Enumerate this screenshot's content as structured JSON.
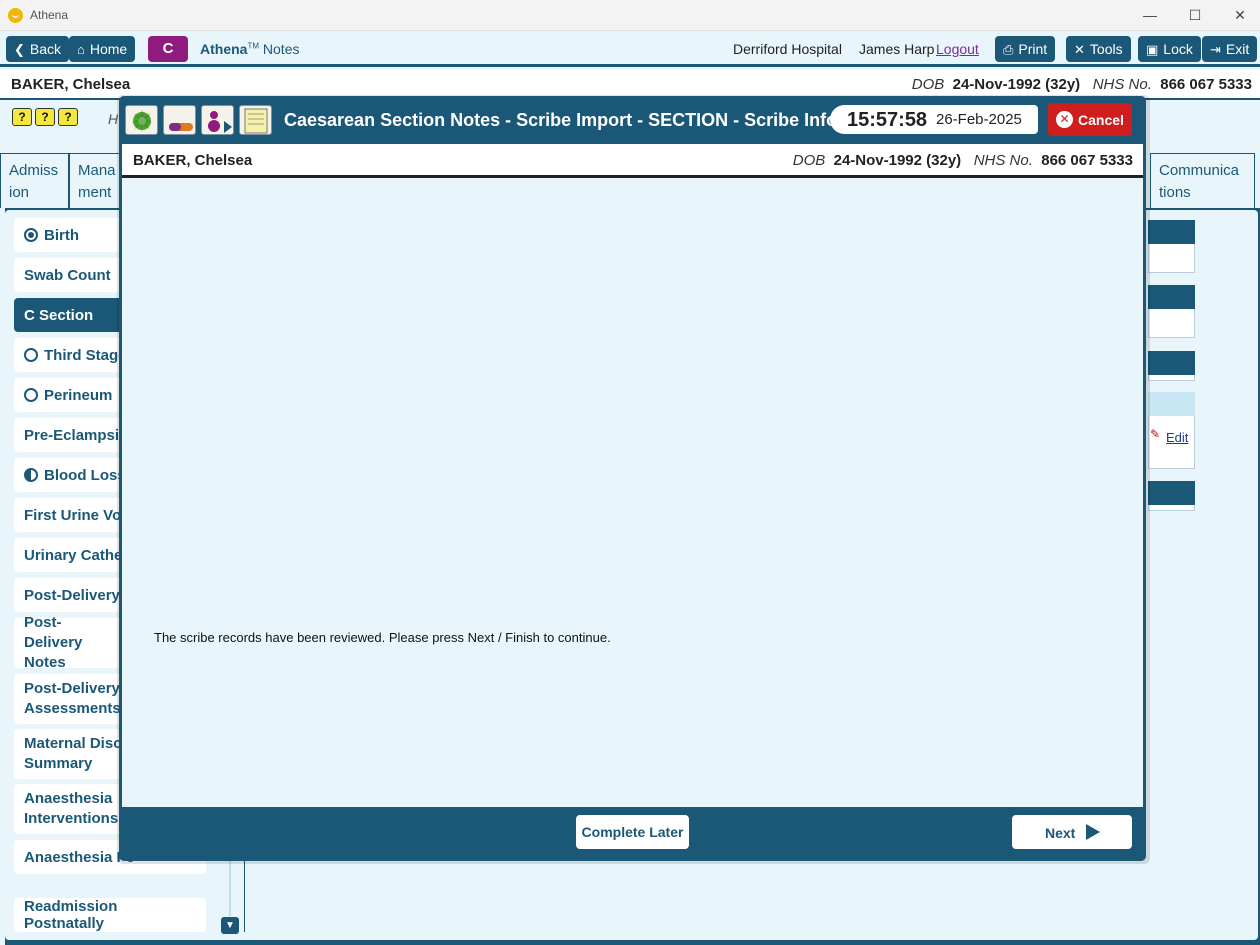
{
  "window": {
    "title": "Athena",
    "minimize": "—",
    "maximize": "☐",
    "close": "✕"
  },
  "topnav": {
    "back": "Back",
    "home": "Home",
    "c_badge": "C",
    "app_brand": "Athena",
    "app_tm": "TM",
    "app_section": "Notes",
    "hospital": "Derriford Hospital",
    "user": "James Harp",
    "logout": "Logout",
    "print": "Print",
    "tools": "Tools",
    "lock": "Lock",
    "exit": "Exit"
  },
  "patient": {
    "name": "BAKER, Chelsea",
    "dob_label": "DOB",
    "dob": "24-Nov-1992 (32y)",
    "nhs_label": "NHS No.",
    "nhs": "866 067 5333"
  },
  "help": {
    "icons": [
      "?",
      "?",
      "?"
    ],
    "label": "H"
  },
  "tabs": [
    {
      "label": "Admiss ion"
    },
    {
      "label": "Mana ment"
    },
    {
      "label": "Communica tions"
    }
  ],
  "sidebar": {
    "items": [
      {
        "label": "Birth",
        "radio": "filled"
      },
      {
        "label": "Swab Count",
        "radio": ""
      },
      {
        "label": "C Section",
        "radio": "",
        "active": true
      },
      {
        "label": "Third Stage",
        "radio": "empty"
      },
      {
        "label": "Perineum",
        "radio": "empty"
      },
      {
        "label": "Pre-Eclampsia",
        "radio": ""
      },
      {
        "label": "Blood Loss",
        "radio": "half"
      },
      {
        "label": "First Urine Voi",
        "radio": ""
      },
      {
        "label": "Urinary Cathe",
        "radio": ""
      },
      {
        "label": "Post-Delivery",
        "radio": ""
      },
      {
        "label": "Post-Delivery Notes",
        "radio": ""
      },
      {
        "label": "Post-Delivery Assessments",
        "radio": ""
      },
      {
        "label": "Maternal Disc Summary",
        "radio": ""
      },
      {
        "label": "Anaesthesia Interventions",
        "radio": ""
      },
      {
        "label": "Anaesthesia Fo",
        "radio": ""
      },
      {
        "label": "Readmission Postnatally",
        "radio": ""
      }
    ]
  },
  "background_panel": {
    "edit": "Edit"
  },
  "modal": {
    "title": "Caesarean Section Notes - Scribe Import - SECTION - Scribe Info",
    "time": "15:57:58",
    "date": "26-Feb-2025",
    "cancel": "Cancel",
    "message": "The scribe records have been reviewed. Please press Next / Finish to continue.",
    "complete_later": "Complete Later",
    "next": "Next",
    "colors": {
      "header": "#1b5878",
      "cancel": "#d01e1e",
      "body": "#e8f6fb"
    }
  }
}
